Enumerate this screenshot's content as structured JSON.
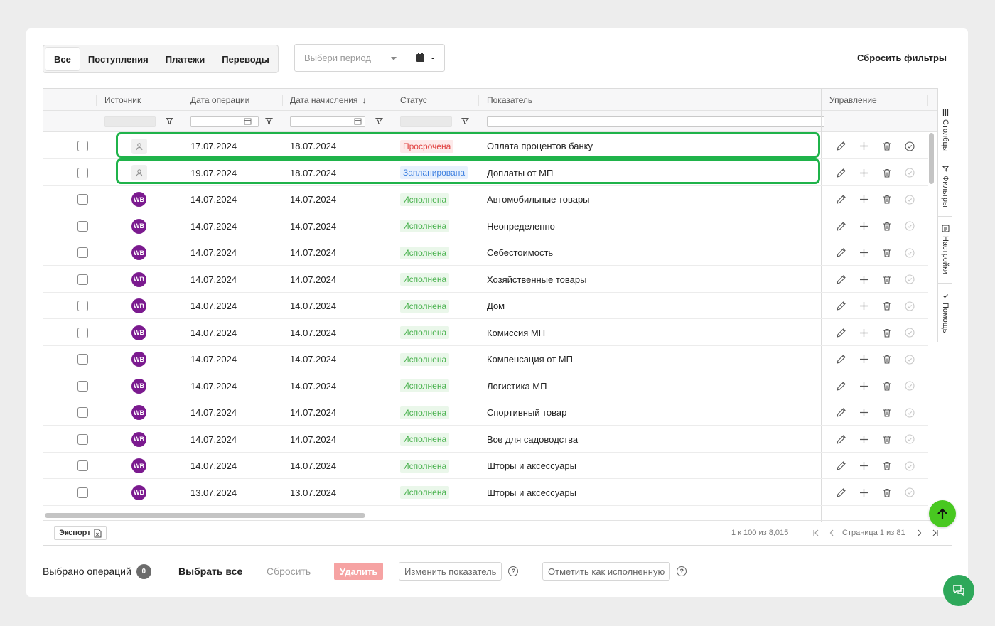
{
  "tabs": [
    {
      "label": "Все",
      "active": true
    },
    {
      "label": "Поступления",
      "active": false
    },
    {
      "label": "Платежи",
      "active": false
    },
    {
      "label": "Переводы",
      "active": false
    }
  ],
  "period": {
    "placeholder": "Выбери период",
    "date_value": "-"
  },
  "reset_filters_label": "Сбросить фильтры",
  "columns": {
    "source": "Источник",
    "op_date": "Дата операции",
    "accrual_date": "Дата начисления",
    "sort_arrow": "↓",
    "status": "Статус",
    "indicator": "Показатель",
    "management": "Управление"
  },
  "rows": [
    {
      "source": "person",
      "op_date": "17.07.2024",
      "accrual_date": "18.07.2024",
      "status": "Просрочена",
      "status_type": "red",
      "indicator": "Оплата процентов банку",
      "done_active": true
    },
    {
      "source": "person",
      "op_date": "19.07.2024",
      "accrual_date": "18.07.2024",
      "status": "Запланирована",
      "status_type": "blue",
      "indicator": "Доплаты от МП",
      "done_active": false
    },
    {
      "source": "WB",
      "op_date": "14.07.2024",
      "accrual_date": "14.07.2024",
      "status": "Исполнена",
      "status_type": "green",
      "indicator": "Автомобильные товары",
      "done_active": false
    },
    {
      "source": "WB",
      "op_date": "14.07.2024",
      "accrual_date": "14.07.2024",
      "status": "Исполнена",
      "status_type": "green",
      "indicator": "Неопределенно",
      "done_active": false
    },
    {
      "source": "WB",
      "op_date": "14.07.2024",
      "accrual_date": "14.07.2024",
      "status": "Исполнена",
      "status_type": "green",
      "indicator": "Себестоимость",
      "done_active": false
    },
    {
      "source": "WB",
      "op_date": "14.07.2024",
      "accrual_date": "14.07.2024",
      "status": "Исполнена",
      "status_type": "green",
      "indicator": "Хозяйственные товары",
      "done_active": false
    },
    {
      "source": "WB",
      "op_date": "14.07.2024",
      "accrual_date": "14.07.2024",
      "status": "Исполнена",
      "status_type": "green",
      "indicator": "Дом",
      "done_active": false
    },
    {
      "source": "WB",
      "op_date": "14.07.2024",
      "accrual_date": "14.07.2024",
      "status": "Исполнена",
      "status_type": "green",
      "indicator": "Комиссия МП",
      "done_active": false
    },
    {
      "source": "WB",
      "op_date": "14.07.2024",
      "accrual_date": "14.07.2024",
      "status": "Исполнена",
      "status_type": "green",
      "indicator": "Компенсация от МП",
      "done_active": false
    },
    {
      "source": "WB",
      "op_date": "14.07.2024",
      "accrual_date": "14.07.2024",
      "status": "Исполнена",
      "status_type": "green",
      "indicator": "Логистика МП",
      "done_active": false
    },
    {
      "source": "WB",
      "op_date": "14.07.2024",
      "accrual_date": "14.07.2024",
      "status": "Исполнена",
      "status_type": "green",
      "indicator": "Спортивный товар",
      "done_active": false
    },
    {
      "source": "WB",
      "op_date": "14.07.2024",
      "accrual_date": "14.07.2024",
      "status": "Исполнена",
      "status_type": "green",
      "indicator": "Все для садоводства",
      "done_active": false
    },
    {
      "source": "WB",
      "op_date": "14.07.2024",
      "accrual_date": "14.07.2024",
      "status": "Исполнена",
      "status_type": "green",
      "indicator": "Шторы и аксессуары",
      "done_active": false
    },
    {
      "source": "WB",
      "op_date": "13.07.2024",
      "accrual_date": "13.07.2024",
      "status": "Исполнена",
      "status_type": "green",
      "indicator": "Шторы и аксессуары",
      "done_active": false
    }
  ],
  "sidebar": [
    {
      "label": "Столбцы",
      "icon": "columns-icon"
    },
    {
      "label": "Фильтры",
      "icon": "filter-icon"
    },
    {
      "label": "Настройки",
      "icon": "settings-icon"
    },
    {
      "label": "Помощь",
      "icon": "help-icon"
    }
  ],
  "footer": {
    "export_label": "Экспорт",
    "range_text": "1 к 100 из 8,015",
    "page_text": "Страница 1 из 81"
  },
  "bottom": {
    "selected_label": "Выбрано операций",
    "selected_count": "0",
    "select_all": "Выбрать все",
    "reset": "Сбросить",
    "delete": "Удалить",
    "change_indicator": "Изменить показатель",
    "mark_done": "Отметить как исполненную",
    "help_glyph": "?"
  },
  "colors": {
    "highlight": "#1fb34a",
    "wb_brand": "#7b1a8f",
    "status_red": "#e0403f",
    "status_blue": "#3d7fe0",
    "status_green": "#47b14c",
    "fab_green": "#48c820"
  }
}
